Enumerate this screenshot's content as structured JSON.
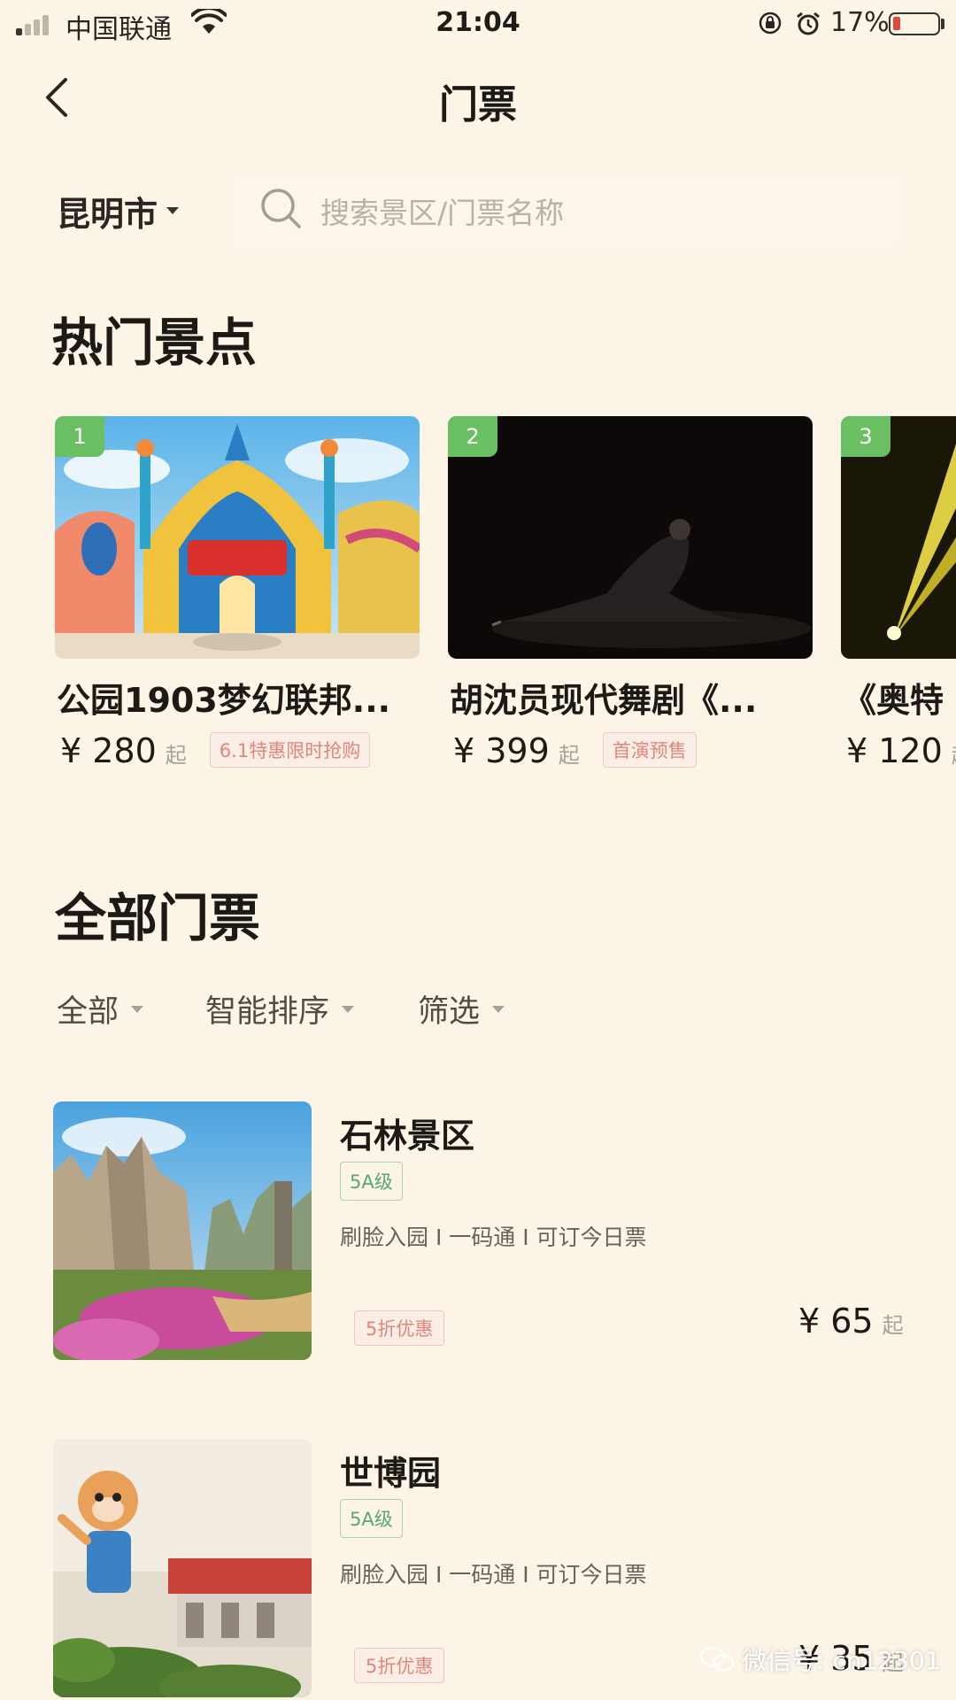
{
  "status_bar": {
    "carrier": "中国联通",
    "time": "21:04",
    "battery": "17%"
  },
  "nav": {
    "title": "门票"
  },
  "search": {
    "city": "昆明市",
    "placeholder": "搜索景区/门票名称"
  },
  "hot": {
    "heading": "热门景点",
    "items": [
      {
        "rank": "1",
        "name": "公园1903梦幻联邦...",
        "price": "¥ 280",
        "suffix": "起",
        "tag": "6.1特惠限时抢购"
      },
      {
        "rank": "2",
        "name": "胡沈员现代舞剧《...",
        "price": "¥ 399",
        "suffix": "起",
        "tag": "首演预售"
      },
      {
        "rank": "3",
        "name": "《奥特",
        "price": "¥ 120",
        "suffix": "起",
        "tag": ""
      }
    ]
  },
  "all": {
    "heading": "全部门票",
    "filters": [
      "全部",
      "智能排序",
      "筛选"
    ],
    "items": [
      {
        "name": "石林景区",
        "level": "5A级",
        "features": "刷脸入园 I 一码通 I 可订今日票",
        "discount": "5折优惠",
        "price": "¥ 65",
        "suffix": "起"
      },
      {
        "name": "世博园",
        "level": "5A级",
        "features": "刷脸入园 I 一码通 I 可订今日票",
        "discount": "5折优惠",
        "price": "¥ 35",
        "suffix": "起"
      }
    ]
  },
  "watermark": "微信号: cn12301",
  "colors": {
    "background": "#fbf4e7",
    "rank_badge": "#6bbf63",
    "promo": "#e2857a",
    "level": "#5aa676"
  }
}
